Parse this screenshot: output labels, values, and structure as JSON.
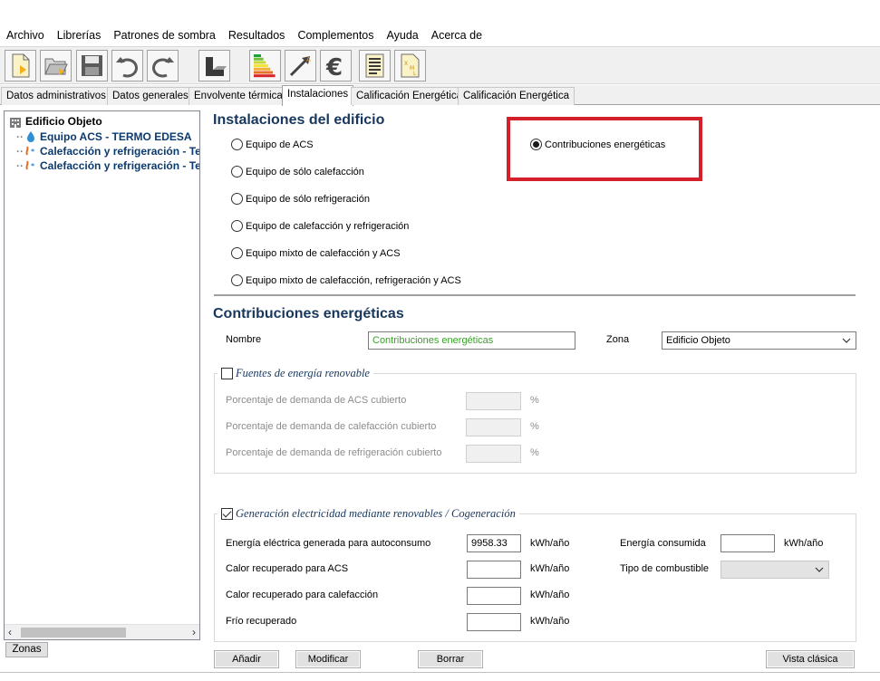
{
  "menu": [
    "Archivo",
    "Librerías",
    "Patrones de sombra",
    "Resultados",
    "Complementos",
    "Ayuda",
    "Acerca de"
  ],
  "toolbar": {
    "icons": [
      "new-file-icon",
      "open-folder-icon",
      "save-icon",
      "undo-icon",
      "redo-icon",
      "building-icon",
      "energy-label-icon",
      "arrow-chart-icon",
      "euro-icon",
      "report-icon",
      "xml-file-icon"
    ],
    "energy_label_colors": [
      "#1f9e3a",
      "#6fbf3a",
      "#c8d83a",
      "#f2e23a",
      "#f3b13a",
      "#e8702a",
      "#d7262a"
    ]
  },
  "tabs": [
    "Datos administrativos",
    "Datos generales",
    "Envolvente térmica",
    "Instalaciones",
    "Calificación Energética",
    "Calificación Energética"
  ],
  "active_tab": "Instalaciones",
  "tree": {
    "root": "Edificio Objeto",
    "items": [
      "Equipo ACS - TERMO EDESA",
      "Calefacción y refrigeración - Te",
      "Calefacción y refrigeración - Te"
    ],
    "zonas_button": "Zonas"
  },
  "installations": {
    "title": "Instalaciones del edificio",
    "options": [
      "Equipo de ACS",
      "Equipo de sólo calefacción",
      "Equipo de sólo refrigeración",
      "Equipo de calefacción y refrigeración",
      "Equipo mixto de calefacción y ACS",
      "Equipo mixto de calefacción, refrigeración y ACS"
    ],
    "selected_option": "Contribuciones energéticas",
    "highlight_color": "#d4202a"
  },
  "contrib": {
    "title": "Contribuciones energéticas",
    "nombre_label": "Nombre",
    "nombre_value": "Contribuciones energéticas",
    "zona_label": "Zona",
    "zona_value": "Edificio Objeto"
  },
  "renewables": {
    "title": "Fuentes de energía renovable",
    "checked": false,
    "rows": [
      {
        "label": "Porcentaje de demanda de ACS cubierto",
        "unit": "%",
        "value": ""
      },
      {
        "label": "Porcentaje de demanda de calefacción cubierto",
        "unit": "%",
        "value": ""
      },
      {
        "label": "Porcentaje de demanda de refrigeración cubierto",
        "unit": "%",
        "value": ""
      }
    ]
  },
  "cogeneration": {
    "title": "Generación electricidad mediante renovables / Cogeneración",
    "checked": true,
    "rows": [
      {
        "label": "Energía eléctrica generada para autoconsumo",
        "value": "9958.33",
        "unit": "kWh/año"
      },
      {
        "label": "Calor recuperado para ACS",
        "value": "",
        "unit": "kWh/año"
      },
      {
        "label": "Calor recuperado para calefacción",
        "value": "",
        "unit": "kWh/año"
      },
      {
        "label": "Frío recuperado",
        "value": "",
        "unit": "kWh/año"
      }
    ],
    "energia_consumida_label": "Energía consumida",
    "energia_consumida_value": "",
    "energia_consumida_unit": "kWh/año",
    "combustible_label": "Tipo de combustible",
    "combustible_value": ""
  },
  "buttons": {
    "add": "Añadir",
    "modify": "Modificar",
    "delete": "Borrar",
    "classic_view": "Vista clásica"
  }
}
